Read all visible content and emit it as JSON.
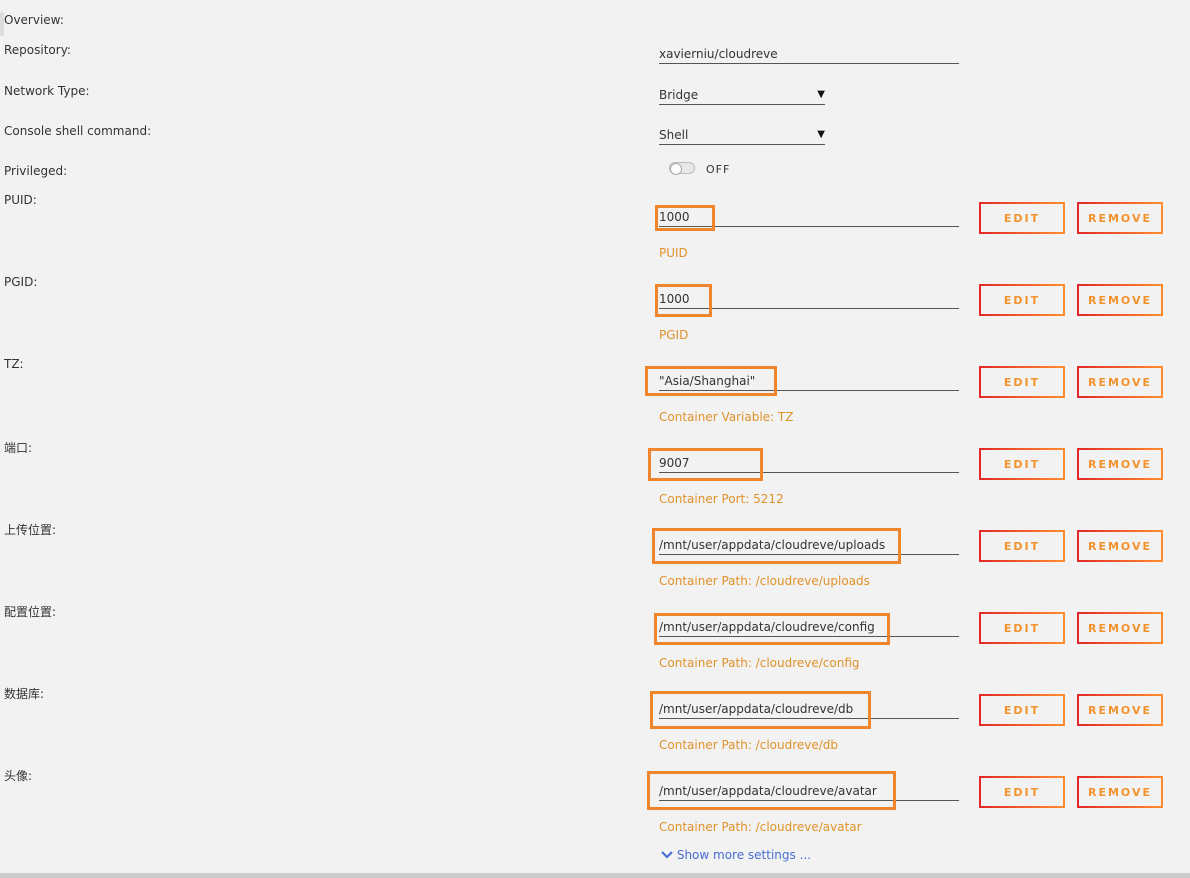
{
  "labels": {
    "overview": "Overview:",
    "repository": "Repository:",
    "network_type": "Network Type:",
    "console": "Console shell command:",
    "privileged": "Privileged:"
  },
  "repository_value": "xavierniu/cloudreve",
  "network_type_value": "Bridge",
  "console_value": "Shell",
  "privileged": {
    "state": "OFF",
    "on": false
  },
  "edit_label": "EDIT",
  "remove_label": "REMOVE",
  "rows": [
    {
      "label": "PUID:",
      "value": "1000",
      "sub": "PUID"
    },
    {
      "label": "PGID:",
      "value": "1000",
      "sub": "PGID"
    },
    {
      "label": "TZ:",
      "value": "\"Asia/Shanghai\"",
      "sub": "Container Variable: TZ"
    },
    {
      "label": "端口:",
      "value": "9007",
      "sub": "Container Port: 5212"
    },
    {
      "label": "上传位置:",
      "value": "/mnt/user/appdata/cloudreve/uploads",
      "sub": "Container Path: /cloudreve/uploads"
    },
    {
      "label": "配置位置:",
      "value": "/mnt/user/appdata/cloudreve/config",
      "sub": "Container Path: /cloudreve/config"
    },
    {
      "label": "数据库:",
      "value": "/mnt/user/appdata/cloudreve/db",
      "sub": "Container Path: /cloudreve/db"
    },
    {
      "label": "头像:",
      "value": "/mnt/user/appdata/cloudreve/avatar",
      "sub": "Container Path: /cloudreve/avatar"
    }
  ],
  "show_more": "Show more settings ...",
  "colors": {
    "highlight": "#f0852d",
    "sub_text": "#e0922a",
    "link": "#486dd3"
  }
}
